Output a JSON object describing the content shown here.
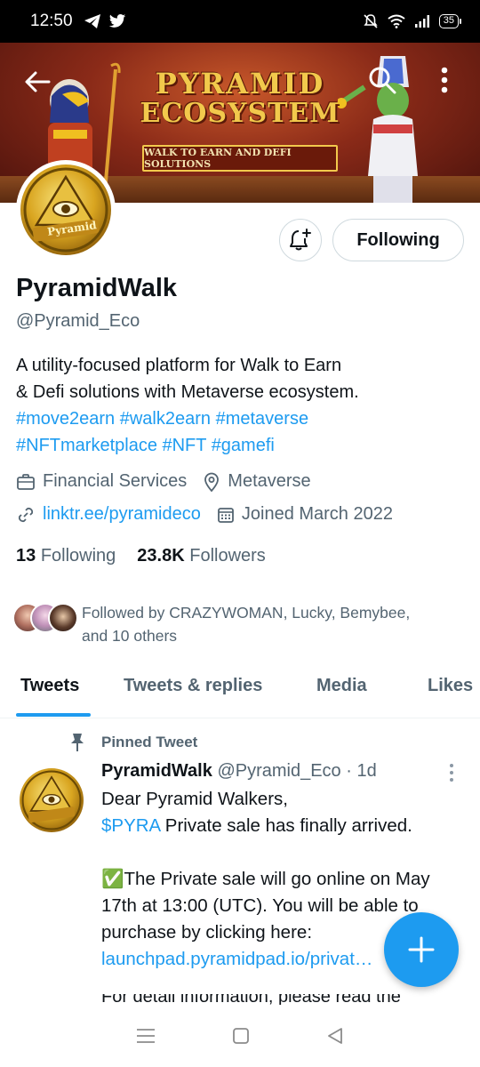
{
  "status_bar": {
    "time": "12:50",
    "battery": "35",
    "left_icons": [
      "telegram-icon",
      "twitter-icon"
    ],
    "right_icons": [
      "mute-icon",
      "wifi-icon",
      "signal-icon",
      "battery-icon"
    ]
  },
  "banner": {
    "title_line1": "PYRAMID",
    "title_line2": "ECOSYSTEM",
    "subtitle": "WALK TO EARN AND DEFI SOLUTIONS"
  },
  "avatar": {
    "logo_text": "Pyramid"
  },
  "profile": {
    "name": "PyramidWalk",
    "handle": "@Pyramid_Eco",
    "follow_button": "Following",
    "bio_line1": "A utility-focused platform for Walk to Earn",
    "bio_line2": "& Defi solutions with Metaverse ecosystem.",
    "hashtags_line1": "#move2earn #walk2earn #metaverse",
    "hashtags_line2": "#NFTmarketplace #NFT #gamefi",
    "category": "Financial Services",
    "location": "Metaverse",
    "link": "linktr.ee/pyramideco",
    "joined": "Joined March 2022",
    "following_count": "13",
    "following_label": "Following",
    "followers_count": "23.8K",
    "followers_label": "Followers",
    "followed_by_line1": "Followed by CRAZYWOMAN, Lucky, Bemybee,",
    "followed_by_line2": "and 10 others"
  },
  "tabs": [
    {
      "label": "Tweets",
      "active": true
    },
    {
      "label": "Tweets & replies",
      "active": false
    },
    {
      "label": "Media",
      "active": false
    },
    {
      "label": "Likes",
      "active": false
    }
  ],
  "tweet": {
    "pinned_label": "Pinned Tweet",
    "author": "PyramidWalk",
    "handle": "@Pyramid_Eco",
    "time": "· 1d",
    "line1": "Dear Pyramid Walkers,",
    "cashtag": "$PYRA",
    "line2_rest": " Private sale has finally arrived.",
    "check": "✅",
    "line3": "The Private sale will go online on May 17th at 13:00 (UTC). You will be able to purchase by clicking here:",
    "link": "launchpad.pyramidpad.io/privat…",
    "cut_line": "For detail information, please read the"
  },
  "colors": {
    "accent": "#1d9bf0",
    "text_primary": "#0f1419",
    "text_secondary": "#536471",
    "border": "#cfd9de"
  }
}
